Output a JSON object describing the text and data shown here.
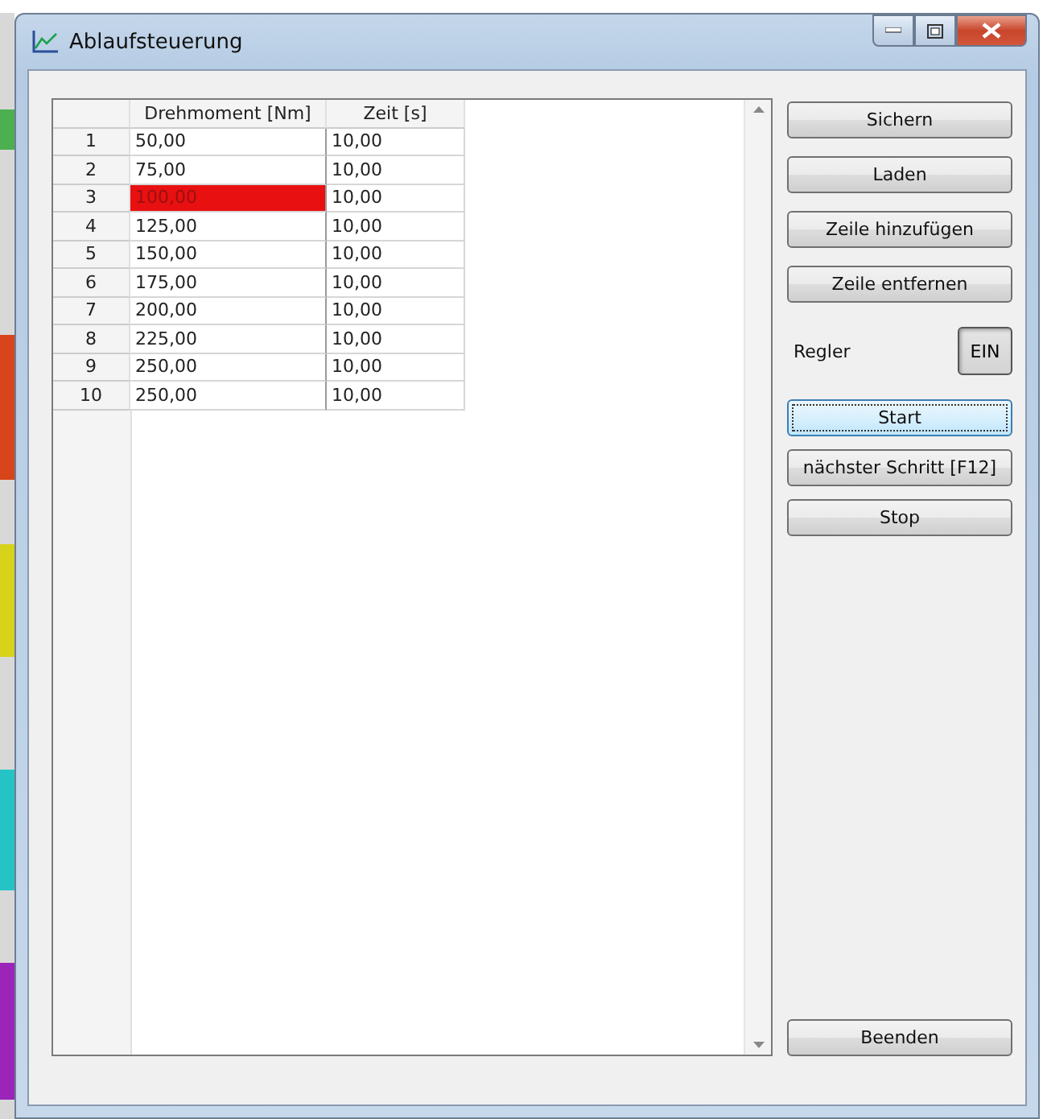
{
  "window": {
    "title": "Ablaufsteuerung"
  },
  "table": {
    "columns": [
      "Drehmoment [Nm]",
      "Zeit [s]"
    ],
    "rows": [
      {
        "number": "1",
        "torque": "50,00",
        "time": "10,00",
        "highlighted": false
      },
      {
        "number": "2",
        "torque": "75,00",
        "time": "10,00",
        "highlighted": false
      },
      {
        "number": "3",
        "torque": "100,00",
        "time": "10,00",
        "highlighted": true
      },
      {
        "number": "4",
        "torque": "125,00",
        "time": "10,00",
        "highlighted": false
      },
      {
        "number": "5",
        "torque": "150,00",
        "time": "10,00",
        "highlighted": false
      },
      {
        "number": "6",
        "torque": "175,00",
        "time": "10,00",
        "highlighted": false
      },
      {
        "number": "7",
        "torque": "200,00",
        "time": "10,00",
        "highlighted": false
      },
      {
        "number": "8",
        "torque": "225,00",
        "time": "10,00",
        "highlighted": false
      },
      {
        "number": "9",
        "torque": "250,00",
        "time": "10,00",
        "highlighted": false
      },
      {
        "number": "10",
        "torque": "250,00",
        "time": "10,00",
        "highlighted": false
      }
    ]
  },
  "top_buttons": [
    {
      "label": "Sichern",
      "focused": false
    },
    {
      "label": "Laden",
      "focused": false
    },
    {
      "label": "Zeile hinzufügen",
      "focused": false
    },
    {
      "label": "Zeile entfernen",
      "focused": false
    }
  ],
  "controller": {
    "label": "Regler",
    "toggle": "EIN",
    "on": true
  },
  "run_buttons": [
    {
      "label": "Start",
      "focused": true
    },
    {
      "label": "nächster Schritt [F12]",
      "focused": false
    },
    {
      "label": "Stop",
      "focused": false
    }
  ],
  "exit_button": {
    "label": "Beenden"
  }
}
